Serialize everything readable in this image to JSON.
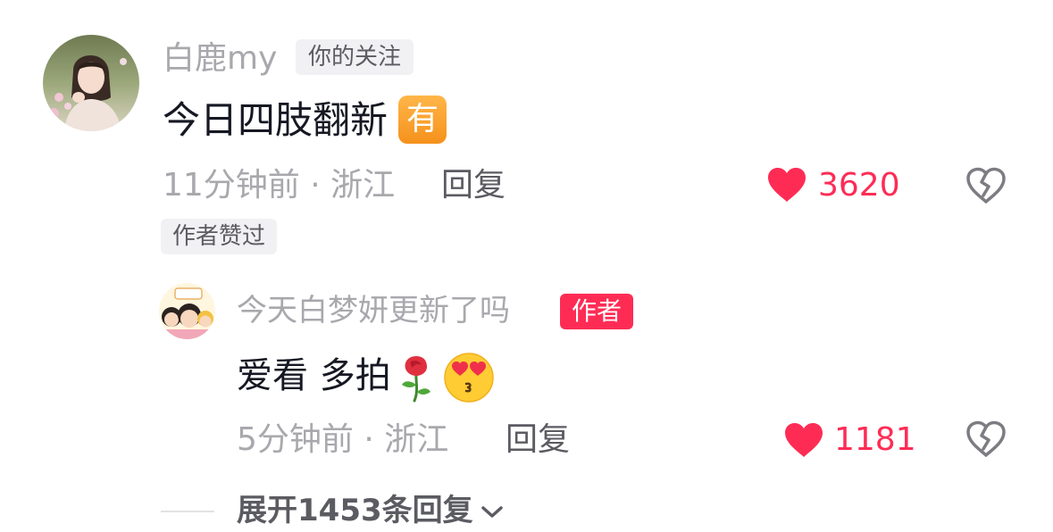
{
  "comment": {
    "username": "白鹿my",
    "follow_badge": "你的关注",
    "text": "今日四肢翻新",
    "you_badge": "有",
    "time_location": "11分钟前 · 浙江",
    "reply_label": "回复",
    "likes": "3620",
    "author_liked_badge": "作者赞过"
  },
  "reply": {
    "username": "今天白梦妍更新了吗",
    "author_badge": "作者",
    "text": "爱看 多拍",
    "time_location": "5分钟前 · 浙江",
    "reply_label": "回复",
    "likes": "1181"
  },
  "expand_label": "展开1453条回复",
  "colors": {
    "like_red": "#fe2c55",
    "secondary_text": "#a8a8ad",
    "primary_text": "#161823",
    "badge_bg": "#f1f1f3"
  },
  "icons": {
    "like": "heart-icon",
    "dislike": "broken-heart-icon",
    "rose": "rose-emoji",
    "heart_eyes_kiss": "kissing-heart-eyes-emoji",
    "expand": "chevron-down-icon"
  }
}
